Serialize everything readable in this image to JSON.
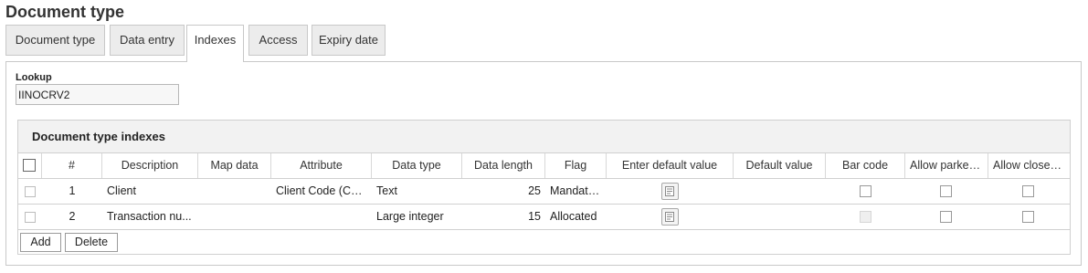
{
  "page_title": "Document type",
  "tabs": [
    {
      "label": "Document type"
    },
    {
      "label": "Data entry"
    },
    {
      "label": "Indexes"
    },
    {
      "label": "Access"
    },
    {
      "label": "Expiry date"
    }
  ],
  "active_tab": "Indexes",
  "lookup": {
    "label": "Lookup",
    "value": "IINOCRV2"
  },
  "grid": {
    "title": "Document type indexes",
    "columns": [
      "#",
      "Description",
      "Map data",
      "Attribute",
      "Data type",
      "Data length",
      "Flag",
      "Enter default value",
      "Default value",
      "Bar code",
      "Allow parked ...",
      "Allow closed ..."
    ],
    "rows": [
      {
        "num": "1",
        "description": "Client",
        "map_data": "",
        "attribute": "Client Code (CLI...",
        "data_type": "Text",
        "data_length": "25",
        "flag": "Mandato...",
        "default_value": "",
        "bar_code": false,
        "bar_code_disabled": false,
        "allow_parked": false,
        "allow_closed": false
      },
      {
        "num": "2",
        "description": "Transaction nu...",
        "map_data": "",
        "attribute": "",
        "data_type": "Large integer",
        "data_length": "15",
        "flag": "Allocated",
        "default_value": "",
        "bar_code": false,
        "bar_code_disabled": true,
        "allow_parked": false,
        "allow_closed": false
      }
    ],
    "buttons": {
      "add": "Add",
      "delete": "Delete"
    }
  },
  "icons": {
    "enter_default_value": "edit-note-icon"
  }
}
